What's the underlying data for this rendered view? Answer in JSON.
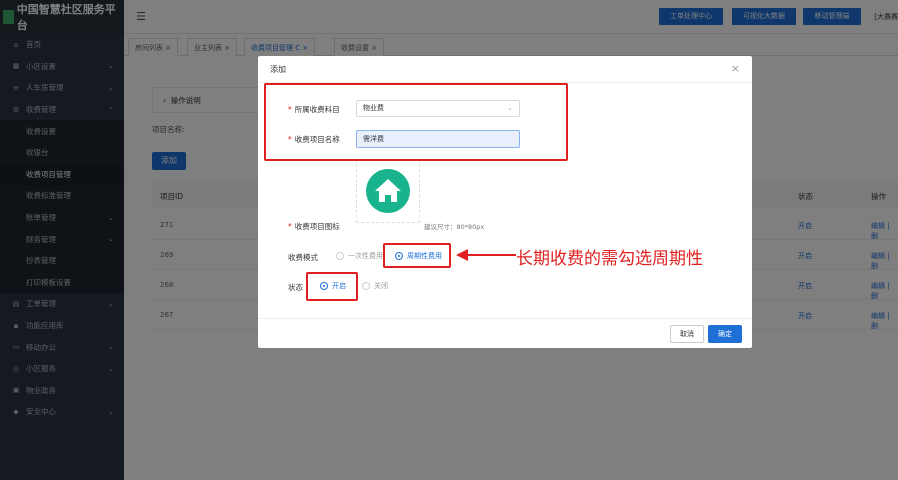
{
  "app": {
    "title": "中国智慧社区服务平台"
  },
  "sidebar": {
    "items": [
      {
        "label": "首页",
        "icon": "home-icon"
      },
      {
        "label": "小区设置",
        "icon": "grid-icon",
        "arrow": "⌄"
      },
      {
        "label": "人车房管理",
        "icon": "layers-icon",
        "arrow": "⌄"
      },
      {
        "label": "收费管理",
        "icon": "gear-icon",
        "arrow": "⌃"
      },
      {
        "label": "收费设置",
        "sub": true
      },
      {
        "label": "收银台",
        "sub": true
      },
      {
        "label": "收费项目管理",
        "sub": true,
        "active": true
      },
      {
        "label": "收费标准管理",
        "sub": true
      },
      {
        "label": "账单管理",
        "sub": true,
        "arrow": "⌄"
      },
      {
        "label": "财务管理",
        "sub": true,
        "arrow": "⌄"
      },
      {
        "label": "抄表管理",
        "sub": true
      },
      {
        "label": "打印模板设置",
        "sub": true
      },
      {
        "label": "工单管理",
        "icon": "ticket-icon",
        "arrow": "⌄"
      },
      {
        "label": "功能应用库",
        "icon": "apps-icon"
      },
      {
        "label": "移动办公",
        "icon": "mobile-icon",
        "arrow": "⌄"
      },
      {
        "label": "小区服务",
        "icon": "service-icon",
        "arrow": "⌄"
      },
      {
        "label": "物业政务",
        "icon": "building-icon"
      },
      {
        "label": "安全中心",
        "icon": "shield-icon",
        "arrow": "⌄"
      }
    ]
  },
  "topbar": {
    "buttons": [
      "工单处理中心",
      "可视化大数据",
      "移动管理端"
    ],
    "user": "[大赛赛"
  },
  "tabs": [
    {
      "label": "房间列表",
      "close": "×"
    },
    {
      "label": "业主列表",
      "close": "×"
    },
    {
      "label": "收费项目管理",
      "close": "C ×",
      "active": true
    },
    {
      "label": "收费设置",
      "close": "×"
    }
  ],
  "main": {
    "collapse_label": "操作说明",
    "search_label": "项目名称:",
    "add_button": "添加",
    "table": {
      "headers": [
        "项目ID",
        "状态",
        "操作"
      ],
      "rows": [
        {
          "id": "271",
          "status": "开启",
          "action": "编辑 | 删"
        },
        {
          "id": "269",
          "status": "开启",
          "action": "编辑 | 删"
        },
        {
          "id": "268",
          "status": "开启",
          "action": "编辑 | 删"
        },
        {
          "id": "267",
          "status": "开启",
          "action": "编辑 | 删"
        }
      ]
    }
  },
  "modal": {
    "title": "添加",
    "close": "×",
    "fields": {
      "category_label": "所属收费科目",
      "category_value": "物业费",
      "name_label": "收费项目名称",
      "name_value": "需洋费",
      "icon_label": "收费项目图标",
      "icon_hint": "建议尺寸：80*80px",
      "mode_label": "收费模式",
      "mode_options": [
        "一次性费用",
        "周期性费用"
      ],
      "status_label": "状态",
      "status_options": [
        "开启",
        "关闭"
      ]
    },
    "cancel": "取消",
    "ok": "确定"
  },
  "annotation": {
    "text": "长期收费的需勾选周期性"
  },
  "colors": {
    "accent": "#1e6fd6",
    "annotation": "#e02020",
    "icon_bg": "#19b48e",
    "sidebar": "#2b3440"
  }
}
